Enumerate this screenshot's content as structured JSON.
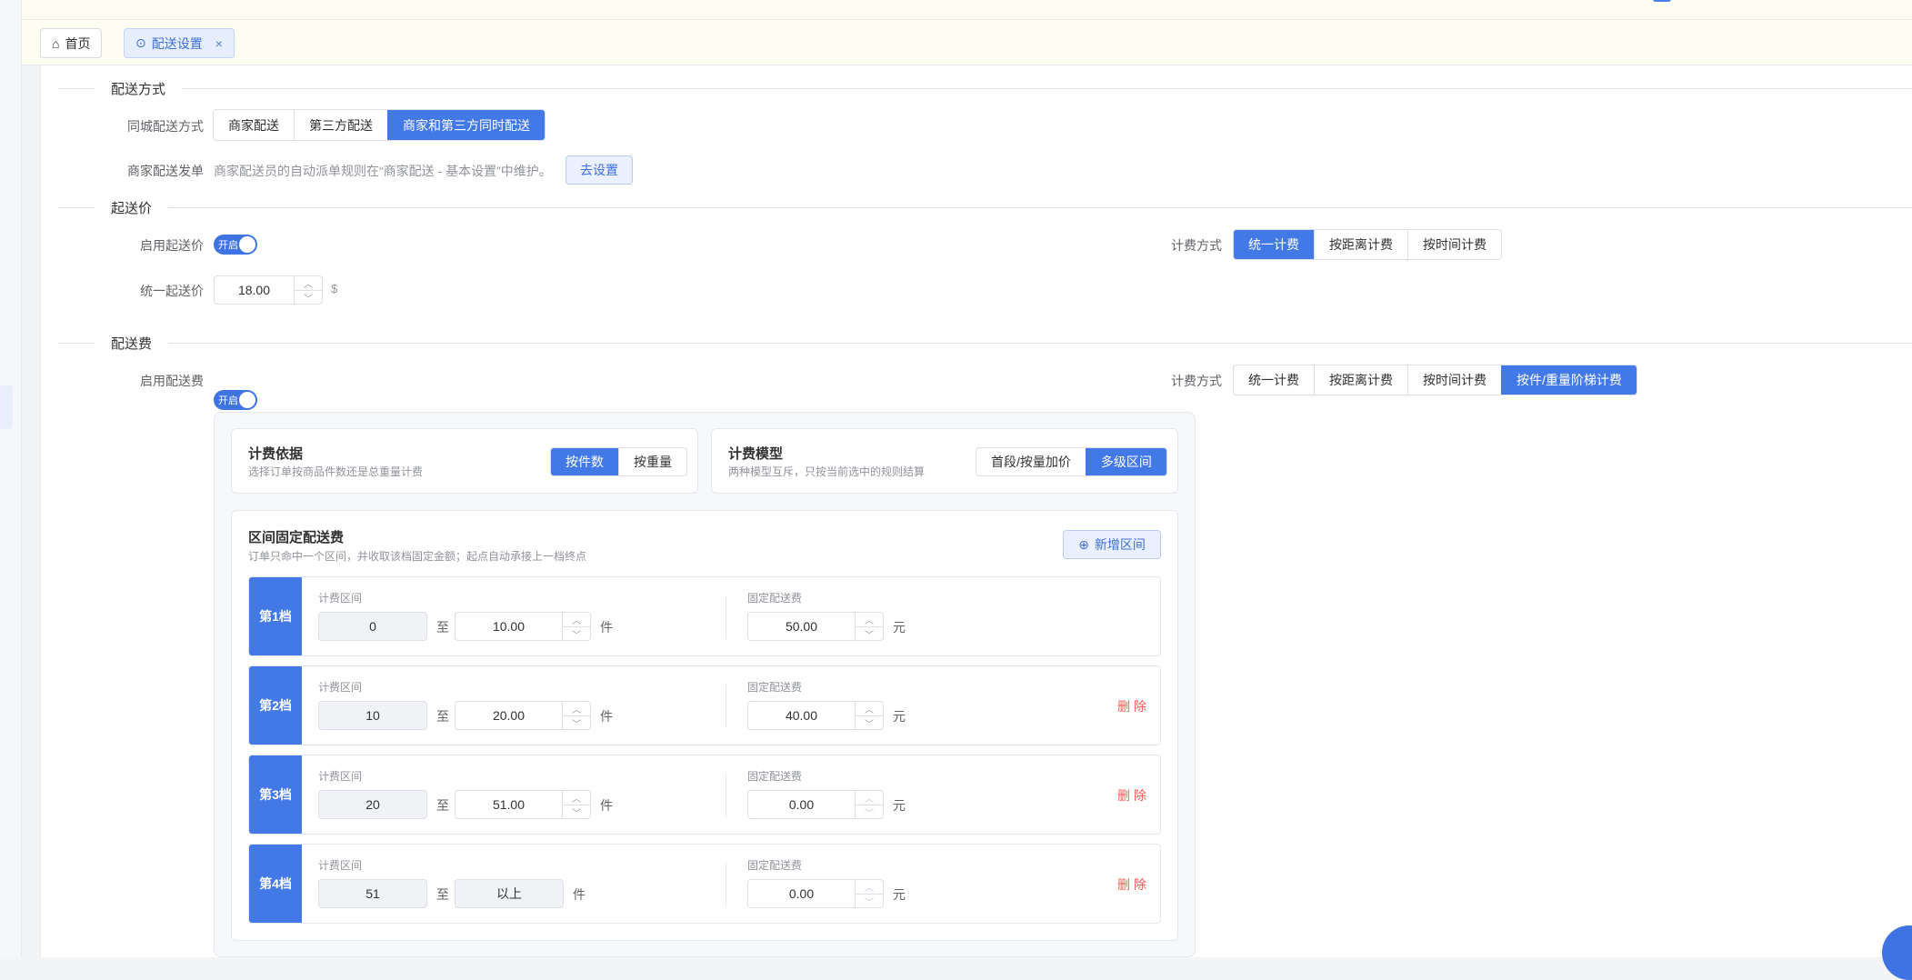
{
  "tabs": [
    {
      "label": "首页",
      "icon": "home-icon"
    },
    {
      "label": "配送设置",
      "icon": "settings-icon",
      "close": "×"
    }
  ],
  "delivery_method": {
    "section_title": "配送方式",
    "city_label": "同城配送方式",
    "options": [
      "商家配送",
      "第三方配送",
      "商家和第三方同时配送"
    ],
    "selected": "商家和第三方同时配送",
    "dispatch_label": "商家配送发单",
    "dispatch_text": "商家配送员的自动派单规则在“商家配送 - 基本设置”中维护。",
    "dispatch_button": "去设置"
  },
  "min_price": {
    "section_title": "起送价",
    "enable_label": "启用起送价",
    "toggle_text": "开启",
    "billing_label": "计费方式",
    "billing_options": [
      "统一计费",
      "按距离计费",
      "按时间计费"
    ],
    "billing_selected": "统一计费",
    "unified_label": "统一起送价",
    "unified_value": "18.00",
    "currency": "$"
  },
  "delivery_fee": {
    "section_title": "配送费",
    "enable_label": "启用配送费",
    "toggle_text": "开启",
    "billing_label": "计费方式",
    "billing_options": [
      "统一计费",
      "按距离计费",
      "按时间计费",
      "按件/重量阶梯计费"
    ],
    "billing_selected": "按件/重量阶梯计费",
    "basis": {
      "title": "计费依据",
      "subtitle": "选择订单按商品件数还是总重量计费",
      "options": [
        "按件数",
        "按重量"
      ],
      "selected": "按件数"
    },
    "model": {
      "title": "计费模型",
      "subtitle": "两种模型互斥，只按当前选中的规则结算",
      "options": [
        "首段/按量加价",
        "多级区间"
      ],
      "selected": "多级区间"
    },
    "interval": {
      "title": "区间固定配送费",
      "subtitle": "订单只命中一个区间，并收取该档固定金额；起点自动承接上一档终点",
      "add_button": "新增区间",
      "range_label": "计费区间",
      "to": "至",
      "count_unit": "件",
      "fee_label": "固定配送费",
      "fee_unit": "元",
      "delete_label": "删除",
      "tiers": [
        {
          "name": "第1档",
          "from": "0",
          "to": "10.00",
          "fee": "50.00"
        },
        {
          "name": "第2档",
          "from": "10",
          "to": "20.00",
          "fee": "40.00"
        },
        {
          "name": "第3档",
          "from": "20",
          "to": "51.00",
          "fee": "0.00"
        },
        {
          "name": "第4档",
          "from": "51",
          "to": "以上",
          "fee": "0.00"
        }
      ]
    }
  }
}
